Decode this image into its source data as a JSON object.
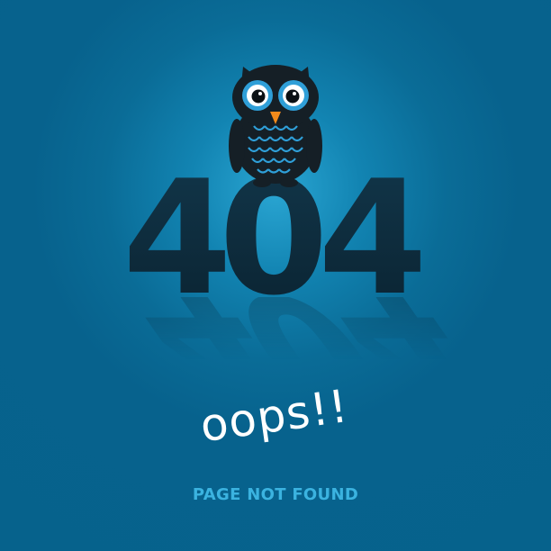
{
  "error_code": "404",
  "digits": [
    "4",
    "0",
    "4"
  ],
  "headline": "oops!!",
  "message": "PAGE NOT FOUND",
  "icons": {
    "mascot": "owl-icon"
  },
  "colors": {
    "background": "#06628c",
    "glow": "#2aa6d3",
    "digit": "#0d2a3b",
    "headline": "#ffffff",
    "message": "#3bb3e0",
    "owl_body": "#151f26",
    "owl_eye": "#2f9fd8",
    "owl_beak": "#f38a1b"
  }
}
